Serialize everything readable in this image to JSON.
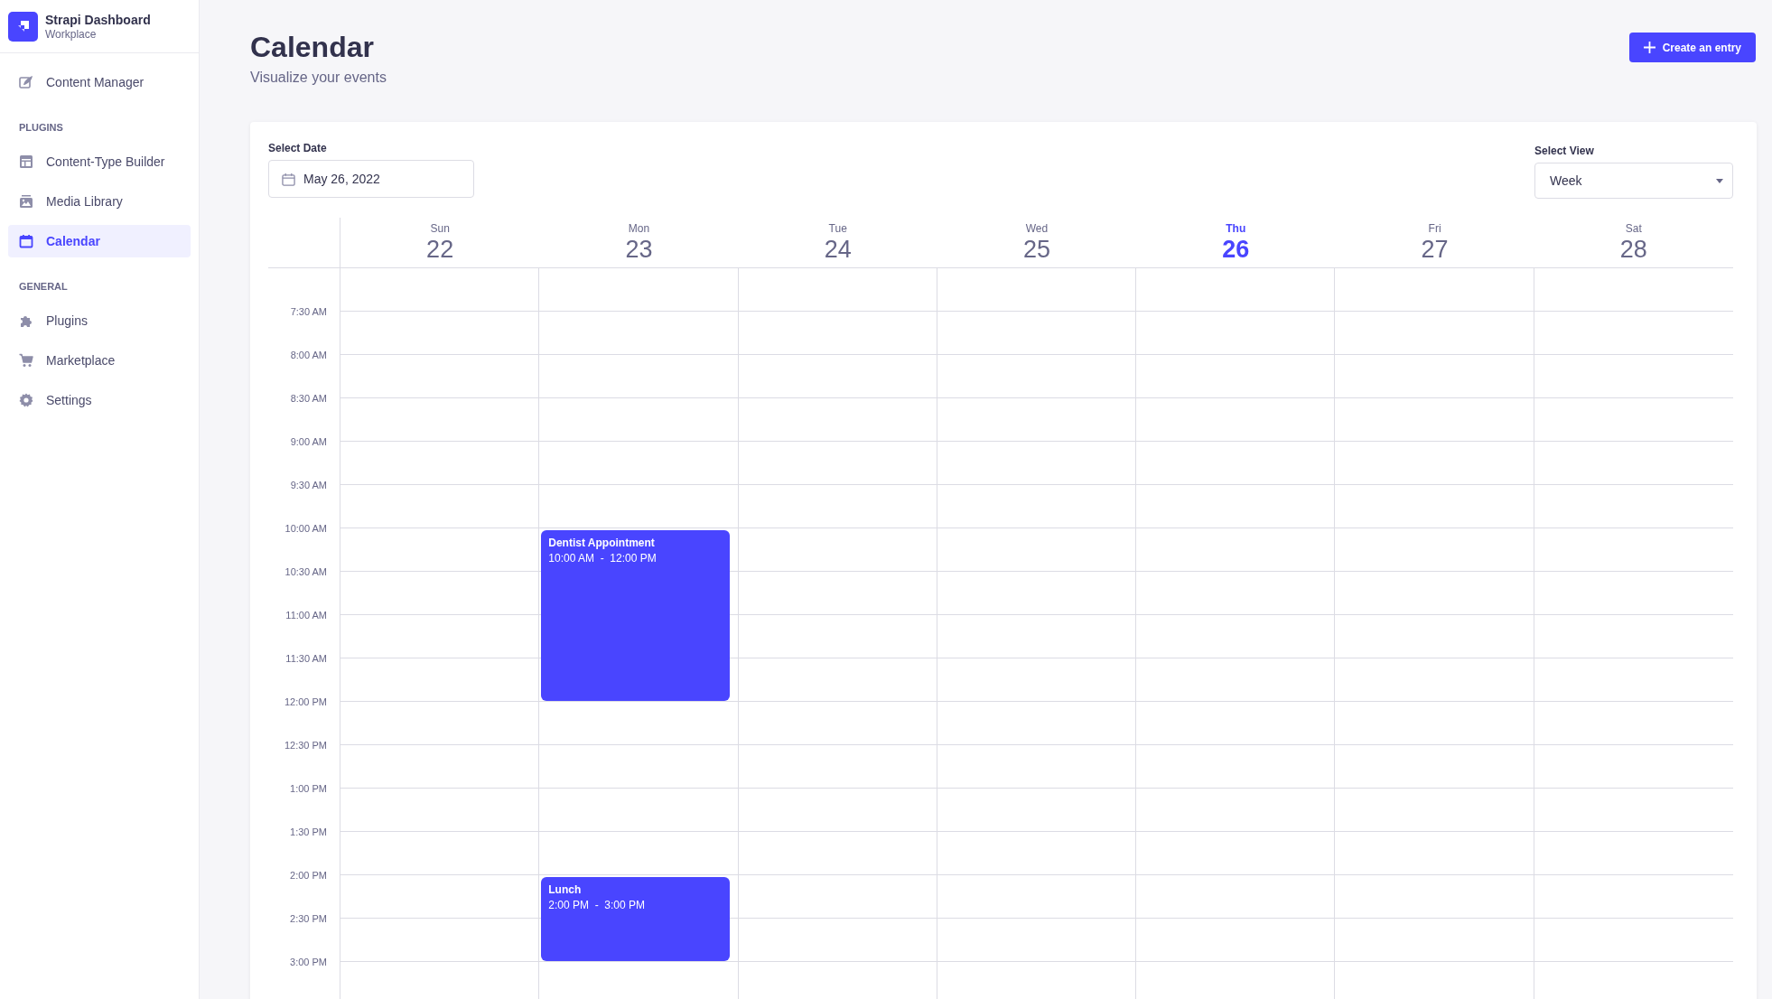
{
  "sidebar": {
    "brand": {
      "title": "Strapi Dashboard",
      "subtitle": "Workplace"
    },
    "sections": [
      {
        "items": [
          {
            "label": "Content Manager",
            "kind": "pen",
            "selected": false
          }
        ]
      },
      {
        "heading": "PLUGINS",
        "items": [
          {
            "label": "Content-Type Builder",
            "kind": "layout",
            "selected": false
          },
          {
            "label": "Media Library",
            "kind": "image",
            "selected": false
          },
          {
            "label": "Calendar",
            "kind": "calendar",
            "selected": true
          }
        ]
      },
      {
        "heading": "GENERAL",
        "items": [
          {
            "label": "Plugins",
            "kind": "puzzle",
            "selected": false
          },
          {
            "label": "Marketplace",
            "kind": "cart",
            "selected": false
          },
          {
            "label": "Settings",
            "kind": "gear",
            "selected": false
          }
        ]
      }
    ]
  },
  "header": {
    "title": "Calendar",
    "subtitle": "Visualize your events",
    "button": "Create an entry"
  },
  "date_field": {
    "label": "Select Date",
    "value": "May 26, 2022"
  },
  "view_field": {
    "label": "Select View",
    "value": "Week"
  },
  "days": [
    {
      "name": "Sun",
      "date": "22",
      "today": false
    },
    {
      "name": "Mon",
      "date": "23",
      "today": false,
      "events": [
        {
          "title": "Dentist Appointment",
          "time": "10:00 AM  -  12:00 PM"
        },
        {
          "title": "Lunch",
          "time": "2:00 PM  -  3:00 PM"
        }
      ]
    },
    {
      "name": "Tue",
      "date": "24",
      "today": false
    },
    {
      "name": "Wed",
      "date": "25",
      "today": false
    },
    {
      "name": "Thu",
      "date": "26",
      "today": true
    },
    {
      "name": "Fri",
      "date": "27",
      "today": false
    },
    {
      "name": "Sat",
      "date": "28",
      "today": false
    }
  ],
  "time_slots": [
    "7:30 AM",
    "8:00 AM",
    "8:30 AM",
    "9:00 AM",
    "9:30 AM",
    "10:00 AM",
    "10:30 AM",
    "11:00 AM",
    "11:30 AM",
    "12:00 PM",
    "12:30 PM",
    "1:00 PM",
    "1:30 PM",
    "2:00 PM",
    "2:30 PM",
    "3:00 PM"
  ]
}
